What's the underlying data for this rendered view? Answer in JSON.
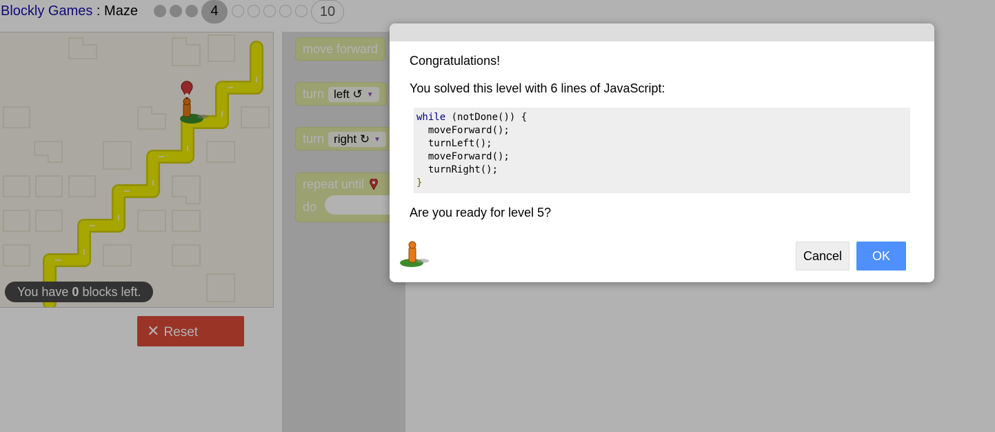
{
  "header": {
    "app_name": "Blockly Games",
    "separator": " : ",
    "game_name": "Maze",
    "levels": [
      "1",
      "2",
      "3",
      "4",
      "5",
      "6",
      "7",
      "8",
      "9",
      "10"
    ],
    "current_level": "4",
    "last_level_label": "10"
  },
  "maze": {
    "blocks_left_prefix": "You have ",
    "blocks_left_count": "0",
    "blocks_left_suffix": " blocks left.",
    "reset_label": "Reset",
    "colors": {
      "path": "#f0ec00",
      "path_edge": "#cfcc00",
      "background": "#f4f1e6",
      "reset": "#dd4b39"
    }
  },
  "toolbox": {
    "move_forward": "move forward",
    "turn_left_word": "turn",
    "turn_left_value": "left ↺",
    "turn_right_word": "turn",
    "turn_right_value": "right ↻",
    "repeat_until": "repeat until",
    "do": "do",
    "block_color": "#e0e7a4"
  },
  "dialog": {
    "congrats": "Congratulations!",
    "solved": "You solved this level with 6 lines of JavaScript:",
    "code": {
      "line1_kw": "while",
      "line1_rest": " (notDone()) {",
      "line2": "  moveForward();",
      "line3": "  turnLeft();",
      "line4": "  moveForward();",
      "line5": "  turnRight();",
      "line6": "}"
    },
    "ready": "Are you ready for level 5?",
    "cancel_label": "Cancel",
    "ok_label": "OK",
    "ok_color": "#4d90fe"
  }
}
